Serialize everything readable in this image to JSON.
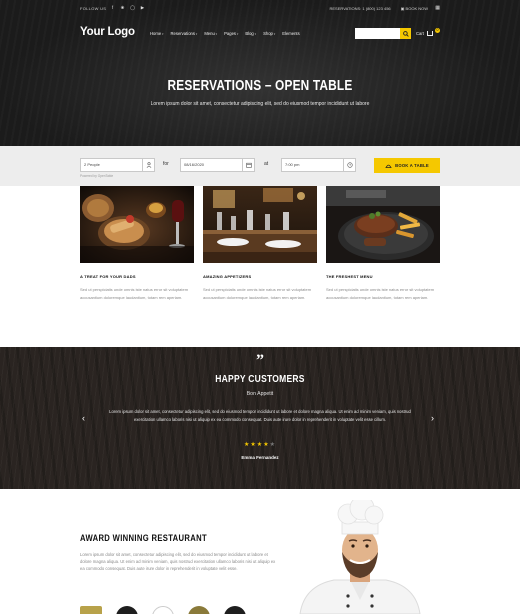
{
  "topbar": {
    "follow_label": "FOLLOW US",
    "contact_phone": "RESERVATIONS: 1 (800) 123 456",
    "contact_book": "BOOK NOW"
  },
  "header": {
    "logo": "Your Logo",
    "nav": [
      "Home",
      "Reservations",
      "Menu",
      "Pages",
      "Blog",
      "Shop",
      "Elements"
    ],
    "cart_label": "Cart",
    "cart_count": "0"
  },
  "hero": {
    "title": "RESERVATIONS – OPEN TABLE",
    "subtitle": "Lorem ipsum dolor sit amet, consectetur adipiscing elit, sed do eiusmod tempor incididunt ut labore"
  },
  "booking": {
    "people_value": "2 People",
    "for_label": "for",
    "date_value": "08/16/2020",
    "at_label": "at",
    "time_value": "7:00 pm",
    "button_label": "BOOK A TABLE",
    "powered_by": "Powered by OpenTable"
  },
  "features": [
    {
      "title": "A TREAT FOR YOUR DADS",
      "text": "Sed ut perspiciatis unde omnis iste natus error sit voluptatem accusantium doloremque laudantium, totam rem aperiam."
    },
    {
      "title": "AMAZING APPETIZERS",
      "text": "Sed ut perspiciatis unde omnis iste natus error sit voluptatem accusantium doloremque laudantium, totam rem aperiam."
    },
    {
      "title": "THE FRESHEST MENU",
      "text": "Sed ut perspiciatis unde omnis iste natus error sit voluptatem accusantium doloremque laudantium, totam rem aperiam."
    }
  ],
  "testimonials": {
    "heading": "HAPPY CUSTOMERS",
    "site": "Bon Appetit",
    "text": "Lorem ipsum dolor sit amet, consectetur adipiscing elit, sed do eiusmod tempor incididunt ut labore et dolore magna aliqua. Ut enim ad minim veniam, quis nostrud exercitation ullamco laboris nisi ut aliquip ex ea commodo consequat. Duis aute irure dolor in reprehenderit in voluptate velit esse cillum.",
    "rating": 4,
    "rating_max": 5,
    "author": "Emma Fernandez"
  },
  "award": {
    "title": "AWARD WINNING RESTAURANT",
    "text": "Lorem ipsum dolor sit amet, consectetur adipiscing elit, sed do eiusmod tempor incididunt ut labore et dolore magna aliqua. Ut enim ad minim veniam, quis nostrud exercitation ullamco laboris nisi ut aliquip ex ea commodo consequat. Duis aute irure dolor in reprehenderit in voluptate velit esse."
  },
  "colors": {
    "accent": "#f5c800",
    "dark_bg": "#1b1b1b",
    "wood_bg": "#2a2421"
  }
}
